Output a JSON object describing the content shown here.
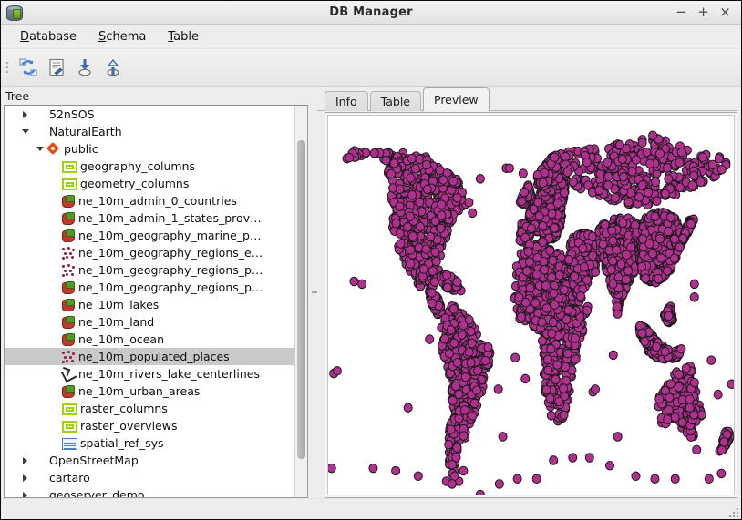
{
  "window": {
    "title": "DB Manager",
    "app_icon": "database-cylinder-icon",
    "controls": {
      "minimize": "−",
      "maximize": "+",
      "close": "×"
    }
  },
  "menubar": {
    "items": [
      {
        "label": "Database",
        "mnemonic": "D",
        "rest": "atabase"
      },
      {
        "label": "Schema",
        "mnemonic": "S",
        "rest": "chema"
      },
      {
        "label": "Table",
        "mnemonic": "T",
        "rest": "able"
      }
    ]
  },
  "toolbar": {
    "buttons": [
      {
        "name": "refresh-icon",
        "tooltip": "Refresh"
      },
      {
        "name": "sql-window-icon",
        "tooltip": "SQL window"
      },
      {
        "name": "import-layer-icon",
        "tooltip": "Import layer/file"
      },
      {
        "name": "export-layer-icon",
        "tooltip": "Export to file"
      }
    ]
  },
  "tree": {
    "title": "Tree",
    "selected": "ne_10m_populated_places",
    "items": [
      {
        "label": "52nSOS",
        "indent": 1,
        "arrow": "right",
        "icon": "none"
      },
      {
        "label": "NaturalEarth",
        "indent": 1,
        "arrow": "down",
        "icon": "none"
      },
      {
        "label": "public",
        "indent": 2,
        "arrow": "down",
        "icon": "schema"
      },
      {
        "label": "geography_columns",
        "indent": 3,
        "arrow": "none",
        "icon": "view"
      },
      {
        "label": "geometry_columns",
        "indent": 3,
        "arrow": "none",
        "icon": "view"
      },
      {
        "label": "ne_10m_admin_0_countries",
        "indent": 3,
        "arrow": "none",
        "icon": "polygon"
      },
      {
        "label": "ne_10m_admin_1_states_prov…",
        "indent": 3,
        "arrow": "none",
        "icon": "polygon"
      },
      {
        "label": "ne_10m_geography_marine_p…",
        "indent": 3,
        "arrow": "none",
        "icon": "polygon"
      },
      {
        "label": "ne_10m_geography_regions_e…",
        "indent": 3,
        "arrow": "none",
        "icon": "point"
      },
      {
        "label": "ne_10m_geography_regions_p…",
        "indent": 3,
        "arrow": "none",
        "icon": "point"
      },
      {
        "label": "ne_10m_geography_regions_p…",
        "indent": 3,
        "arrow": "none",
        "icon": "polygon"
      },
      {
        "label": "ne_10m_lakes",
        "indent": 3,
        "arrow": "none",
        "icon": "polygon"
      },
      {
        "label": "ne_10m_land",
        "indent": 3,
        "arrow": "none",
        "icon": "polygon"
      },
      {
        "label": "ne_10m_ocean",
        "indent": 3,
        "arrow": "none",
        "icon": "polygon"
      },
      {
        "label": "ne_10m_populated_places",
        "indent": 3,
        "arrow": "none",
        "icon": "point",
        "selected": true
      },
      {
        "label": "ne_10m_rivers_lake_centerlines",
        "indent": 3,
        "arrow": "none",
        "icon": "line"
      },
      {
        "label": "ne_10m_urban_areas",
        "indent": 3,
        "arrow": "none",
        "icon": "polygon"
      },
      {
        "label": "raster_columns",
        "indent": 3,
        "arrow": "none",
        "icon": "view"
      },
      {
        "label": "raster_overviews",
        "indent": 3,
        "arrow": "none",
        "icon": "view"
      },
      {
        "label": "spatial_ref_sys",
        "indent": 3,
        "arrow": "none",
        "icon": "table-ico"
      },
      {
        "label": "OpenStreetMap",
        "indent": 1,
        "arrow": "right",
        "icon": "none"
      },
      {
        "label": "cartaro",
        "indent": 1,
        "arrow": "right",
        "icon": "none"
      },
      {
        "label": "geoserver_demo",
        "indent": 1,
        "arrow": "right",
        "icon": "none"
      }
    ]
  },
  "tabs": {
    "items": [
      {
        "label": "Info",
        "active": false
      },
      {
        "label": "Table",
        "active": false
      },
      {
        "label": "Preview",
        "active": true
      }
    ]
  },
  "preview": {
    "layer": "ne_10m_populated_places",
    "geometry": "point",
    "marker_fill": "#b0308f",
    "marker_stroke": "#1a1a1a",
    "marker_radius": 4.6,
    "background": "#ffffff"
  }
}
